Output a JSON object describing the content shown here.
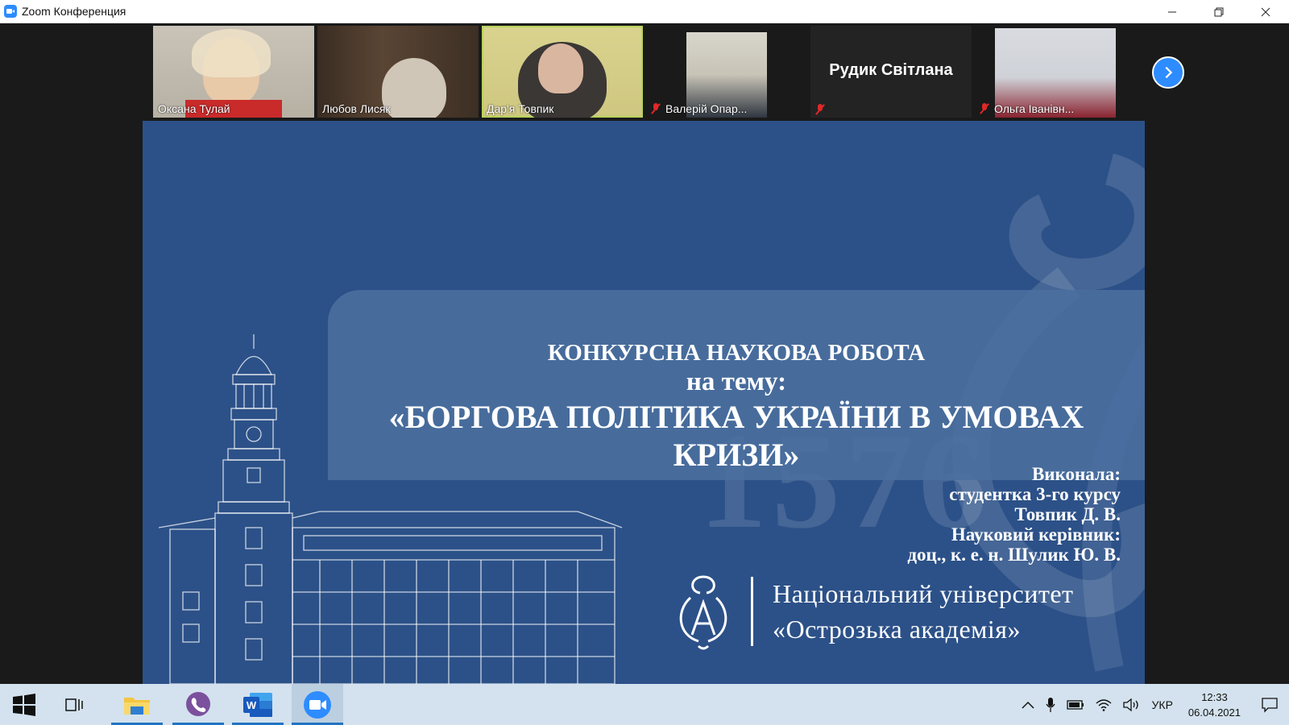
{
  "window": {
    "title": "Zoom Конференция",
    "controls": {
      "minimize": "—",
      "restore": "❐",
      "close": "✕"
    }
  },
  "participants": [
    {
      "name": "Оксана Тулай",
      "muted": false,
      "video": true
    },
    {
      "name": "Любов Лисяк",
      "muted": false,
      "video": true
    },
    {
      "name": "Дар'я Товпик",
      "muted": false,
      "video": true,
      "active_speaker": true
    },
    {
      "name": "Валерій Опар...",
      "muted": true,
      "video": true
    },
    {
      "name": "",
      "display_name": "Рудик Світлана",
      "muted": true,
      "video": false
    },
    {
      "name": "Ольга Іванівн...",
      "muted": true,
      "video": true
    }
  ],
  "slide": {
    "heading_line1": "КОНКУРСНА НАУКОВА РОБОТА",
    "heading_line2": "на тему:",
    "heading_line3": "«БОРГОВА ПОЛІТИКА УКРАЇНИ В УМОВАХ КРИЗИ»",
    "author_lines": [
      "Виконала:",
      "студентка 3-го курсу",
      "Товпик Д. В.",
      "Науковий керівник:",
      "доц., к. е. н. Шулик Ю. В."
    ],
    "university_line1": "Національний університет",
    "university_line2": "«Острозька академія»",
    "watermark": "1576",
    "background_color": "#2c5188"
  },
  "taskbar": {
    "apps": [
      "windows-start",
      "task-view",
      "file-explorer",
      "viber",
      "word",
      "zoom"
    ],
    "language": "УКР",
    "time": "12:33",
    "date": "06.04.2021"
  }
}
